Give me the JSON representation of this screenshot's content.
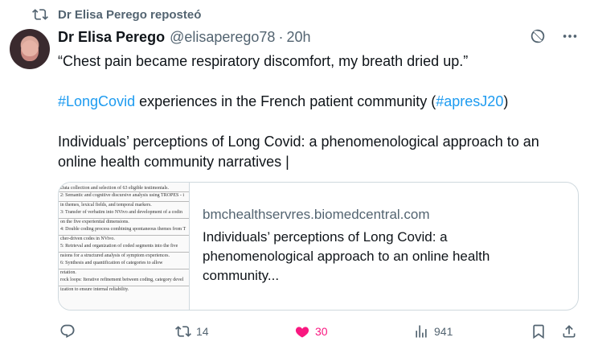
{
  "repost": {
    "text": "Dr Elisa Perego reposteó",
    "icon": "repost-icon"
  },
  "author": {
    "name": "Dr Elisa Perego",
    "handle": "@elisaperego78",
    "separator": "·",
    "time": "20h"
  },
  "tweet": {
    "line1": "“Chest pain became respiratory discomfort, my breath dried up.”",
    "line2_hashtag1": "#LongCovid",
    "line2_text": " experiences in the French patient community (",
    "line2_hashtag2": "#apresJ20",
    "line2_end": ")",
    "line3": "Individuals’ perceptions of Long Covid: a phenomenological approach to an online health community narratives |"
  },
  "card": {
    "domain": "bmchealthservres.biomedcentral.com",
    "title": "Individuals’ perceptions of Long Covid: a phenomenological approach to an online health community...",
    "thumb_lines": [
      "Data collection and selection of 63 eligible testimonials.",
      "2: Semantic and cognitive discursive analysis using TROPES - i",
      "in themes, lexical fields, and temporal markers.",
      "3: Transfer of verbatim into NVivo and development of a codin",
      "on the five experiential dimensions.",
      "4: Double coding process combining spontaneous themes from T",
      "cher-driven codes in NVivo.",
      "5: Retrieval and organization of coded segments into the five",
      "nsions for a structured analysis of symptom experiences.",
      "6: Synthesis and quantification of categories to allow",
      "retation.",
      "rock loops: Iterative refinement between coding, category devel",
      "ization to ensure internal reliability."
    ]
  },
  "actions": {
    "reply": "",
    "retweets": "14",
    "likes": "30",
    "views": "941"
  },
  "colors": {
    "accent": "#1d9bf0",
    "like": "#f91880",
    "muted": "#536471"
  }
}
